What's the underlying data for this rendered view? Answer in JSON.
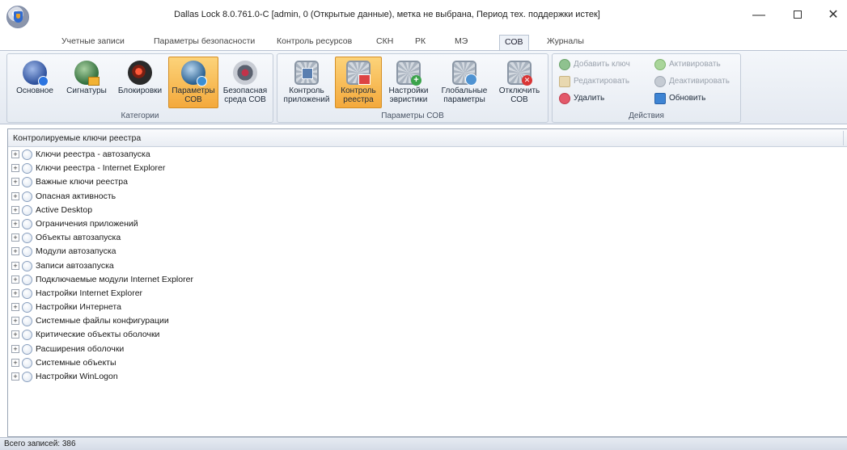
{
  "window": {
    "title": "Dallas Lock 8.0.761.0-C [admin, 0 (Открытые данные), метка не выбрана, Период тех. поддержки истек]",
    "minimize_glyph": "—",
    "close_glyph": "✕"
  },
  "ribbon_tabs": [
    {
      "label": "Учетные записи",
      "active": false
    },
    {
      "label": "Параметры безопасности",
      "active": false
    },
    {
      "label": "Контроль ресурсов",
      "active": false
    },
    {
      "label": "СКН",
      "active": false
    },
    {
      "label": "РК",
      "active": false
    },
    {
      "label": "МЭ",
      "active": false
    },
    {
      "label": "СОВ",
      "active": true
    },
    {
      "label": "Журналы",
      "active": false
    }
  ],
  "groups": {
    "categories": {
      "label": "Категории",
      "buttons": [
        {
          "label": "Основное",
          "icon": "basic-icon"
        },
        {
          "label": "Сигнатуры",
          "icon": "signatures-icon"
        },
        {
          "label": "Блокировки",
          "icon": "blocks-icon"
        },
        {
          "label": "Параметры СОВ",
          "icon": "ids-params-icon",
          "active": true
        },
        {
          "label": "Безопасная среда СОВ",
          "icon": "safe-env-icon"
        }
      ]
    },
    "ids_params": {
      "label": "Параметры СОВ",
      "buttons": [
        {
          "label": "Контроль приложений",
          "icon": "app-control-gear-icon"
        },
        {
          "label": "Контроль реестра",
          "icon": "registry-control-gear-icon",
          "active": true
        },
        {
          "label": "Настройки эвристики",
          "icon": "heuristics-gear-icon"
        },
        {
          "label": "Глобальные параметры",
          "icon": "global-params-gear-icon"
        },
        {
          "label": "Отключить СОВ",
          "icon": "disable-ids-gear-icon"
        }
      ]
    },
    "actions": {
      "label": "Действия",
      "add_key": "Добавить ключ",
      "activate": "Активировать",
      "edit": "Редактировать",
      "deactivate": "Деактивировать",
      "delete": "Удалить",
      "refresh": "Обновить"
    }
  },
  "list": {
    "header": "Контролируемые ключи реестра",
    "expander_glyph": "+",
    "rows": [
      "Ключи реестра - автозапуска",
      "Ключи реестра - Internet Explorer",
      "Важные ключи реестра",
      "Опасная активность",
      "Active Desktop",
      "Ограничения приложений",
      "Объекты автозапуска",
      "Модули автозапуска",
      "Записи автозапуска",
      "Подключаемые модули Internet Explorer",
      "Настройки Internet Explorer",
      "Настройки Интернета",
      "Системные файлы конфигурации",
      "Критические объекты оболочки",
      "Расширения оболочки",
      "Системные объекты",
      "Настройки WinLogon"
    ]
  },
  "status": {
    "total_records": "Всего записей: 386"
  },
  "colors": {
    "accent_active": "#f4a93c",
    "ribbon_bg": "#e4e9f1",
    "border": "#9aa5b5"
  }
}
